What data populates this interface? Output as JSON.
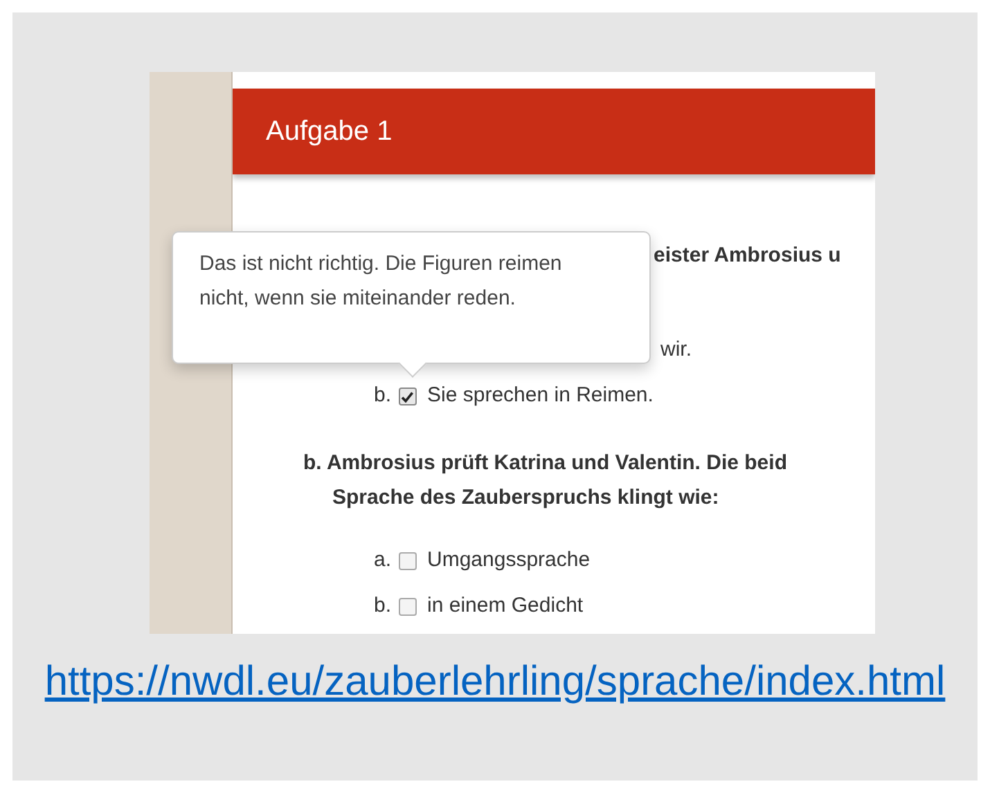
{
  "screenshot": {
    "header": {
      "title": "Aufgabe 1"
    },
    "question_a": {
      "visible_text": "eister Ambrosius u",
      "options": [
        {
          "kind": "partial",
          "text": "wir."
        },
        {
          "kind": "full",
          "label": "b.",
          "text": "Sie sprechen in Reimen.",
          "checked": true
        }
      ]
    },
    "question_b": {
      "lines": [
        "b. Ambrosius prüft Katrina und Valentin. Die beid",
        "Sprache des Zauberspruchs klingt wie:"
      ],
      "options": [
        {
          "kind": "full",
          "label": "a.",
          "text": "Umgangssprache",
          "checked": false
        },
        {
          "kind": "full",
          "label": "b.",
          "text": "in einem Gedicht",
          "checked": false
        }
      ]
    },
    "tooltip": {
      "text": "Das ist nicht richtig. Die Figuren reimen nicht, wenn sie miteinander reden."
    }
  },
  "url": "https://nwdl.eu/zauberlehrling/sprache/index.html"
}
